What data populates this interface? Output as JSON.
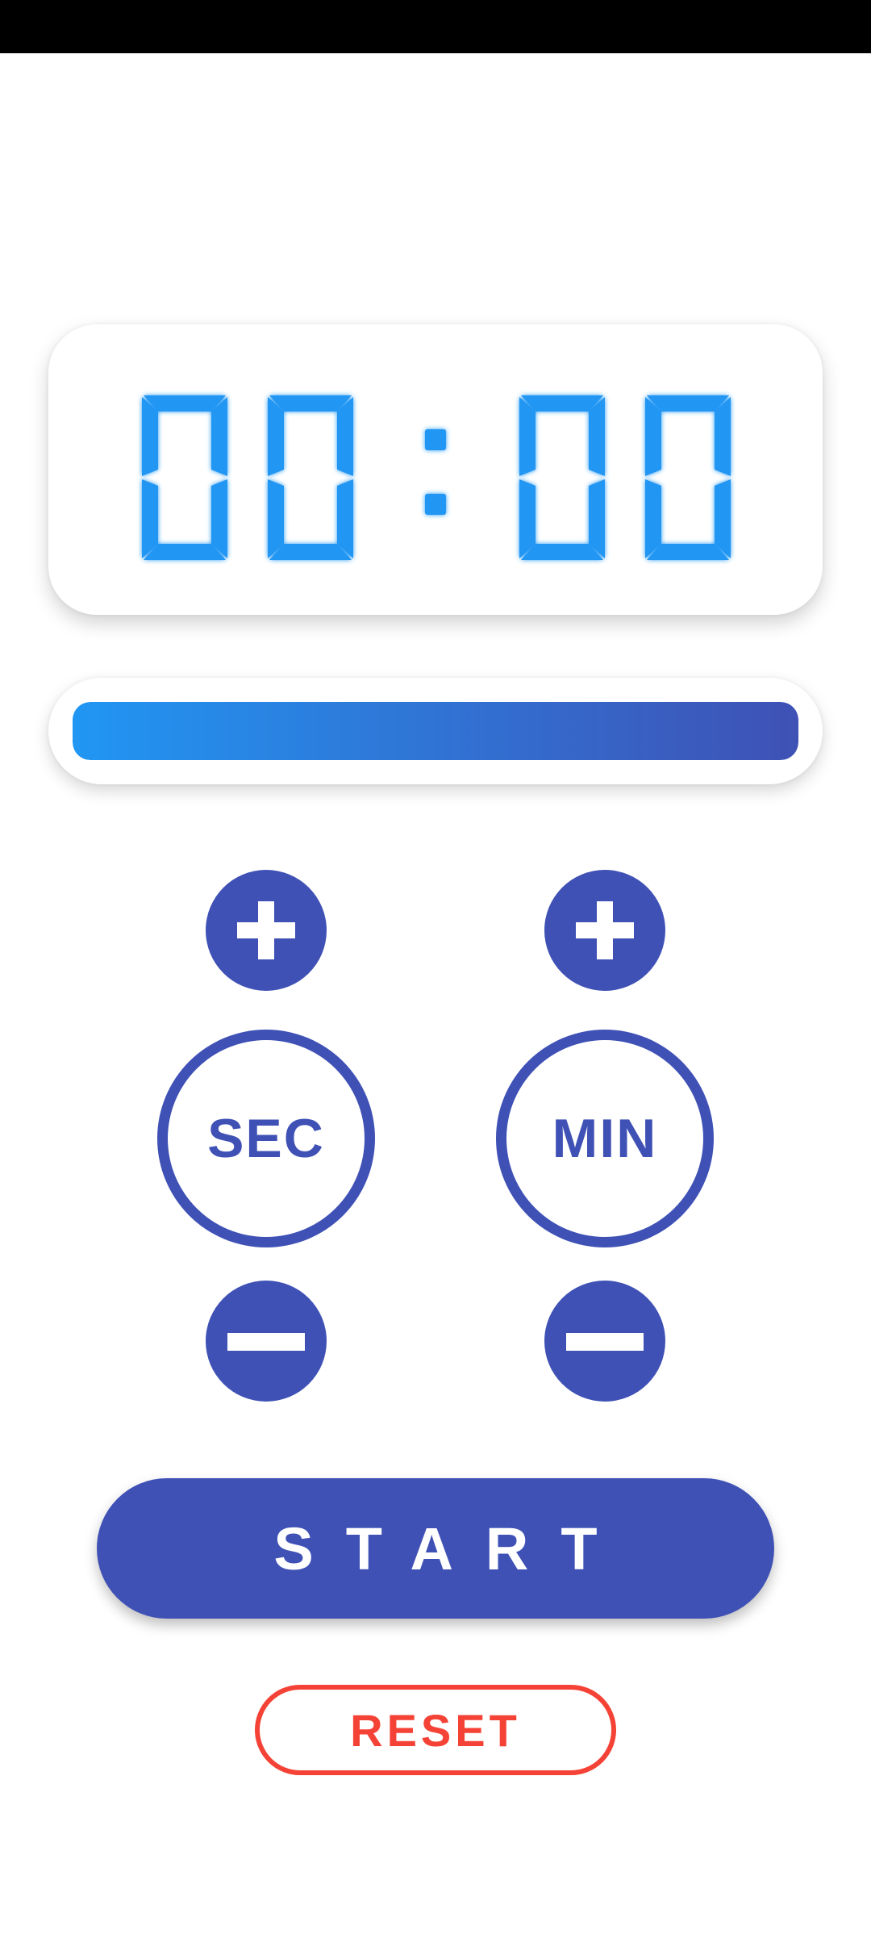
{
  "timer": {
    "minutes": "00",
    "seconds": "00",
    "separator": ":"
  },
  "progress": {
    "fraction": 1.0
  },
  "controls": {
    "seconds_label": "SEC",
    "minutes_label": "MIN",
    "increment_icon": "plus-icon",
    "decrement_icon": "minus-icon"
  },
  "actions": {
    "start_label": "START",
    "reset_label": "RESET"
  },
  "colors": {
    "primary": "#3F51B5",
    "digit": "#2196F3",
    "progress_start": "#2196F3",
    "progress_end": "#3F51B5",
    "reset": "#F44336",
    "status_bar": "#000000"
  }
}
